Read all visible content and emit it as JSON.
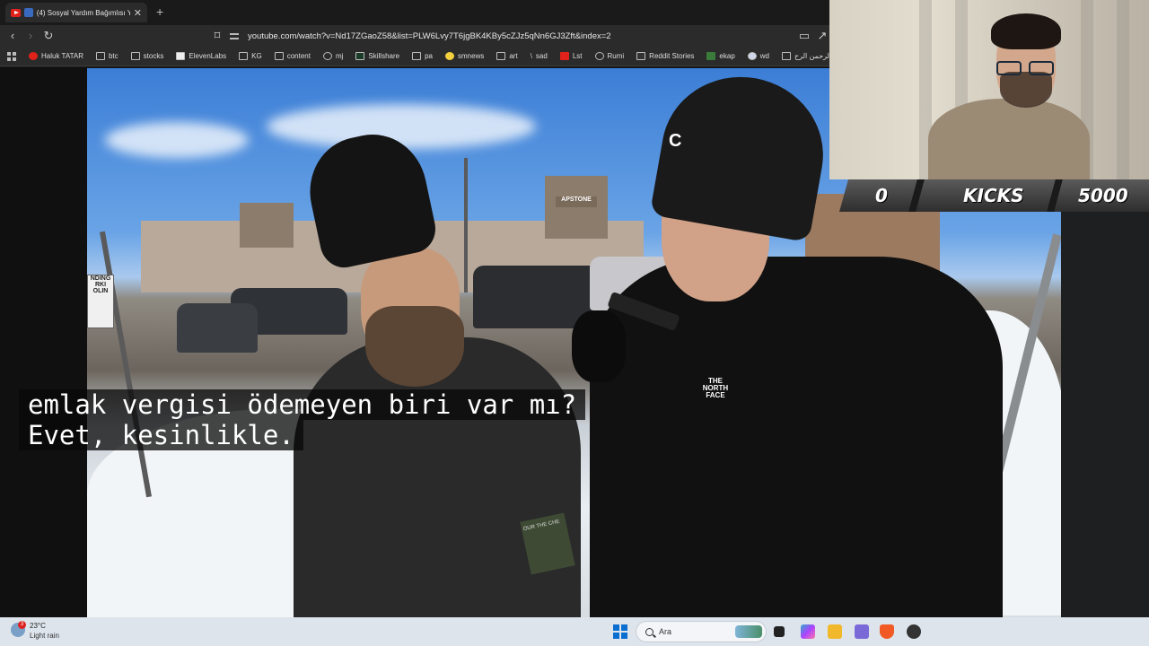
{
  "browser": {
    "tab": {
      "title": "(4) Sosyal Yardım Bağımlısı Y..."
    },
    "new_tab": "+",
    "url": "youtube.com/watch?v=Nd17ZGaoZ58&list=PLW6Lvy7T6jgBK4KBy5cZJz5qNn6GJ3Zft&index=2",
    "bookmarks": [
      {
        "label": "Haluk TATAR",
        "icon": "youtube-icon"
      },
      {
        "label": "btc",
        "icon": "folder-icon"
      },
      {
        "label": "stocks",
        "icon": "folder-icon"
      },
      {
        "label": "ElevenLabs",
        "icon": "elevenlabs-icon"
      },
      {
        "label": "KG",
        "icon": "folder-icon"
      },
      {
        "label": "content",
        "icon": "folder-icon"
      },
      {
        "label": "mj",
        "icon": "github-icon"
      },
      {
        "label": "Skillshare",
        "icon": "skillshare-icon"
      },
      {
        "label": "pa",
        "icon": "folder-icon"
      },
      {
        "label": "smnews",
        "icon": "smiley-icon"
      },
      {
        "label": "art",
        "icon": "folder-icon"
      },
      {
        "label": "sad",
        "icon": "slash-icon"
      },
      {
        "label": "Lst",
        "icon": "s-icon"
      },
      {
        "label": "Rumi",
        "icon": "globe-icon"
      },
      {
        "label": "Reddit Stories",
        "icon": "d-icon"
      },
      {
        "label": "ekap",
        "icon": "leaf-icon"
      },
      {
        "label": "wd",
        "icon": "w-icon"
      },
      {
        "label": "الله الرحمن الرح...",
        "icon": "page-icon"
      }
    ]
  },
  "video": {
    "subtitle_line1": "emlak vergisi ödemeyen biri var mı?",
    "subtitle_line2": "Evet, kesinlikle.",
    "sign_text": "NDING RKI OLIN",
    "shop_sign": "APSTONE",
    "beanie_logo": "C",
    "northface_logo": "THE NORTH FACE",
    "book_text": "OUR THE CHE"
  },
  "kicks": {
    "left_value": "0",
    "label": "KICKS",
    "right_value": "5000"
  },
  "taskbar": {
    "weather_badge": "3",
    "temperature": "23°C",
    "weather_desc": "Light rain",
    "search_label": "Ara"
  }
}
